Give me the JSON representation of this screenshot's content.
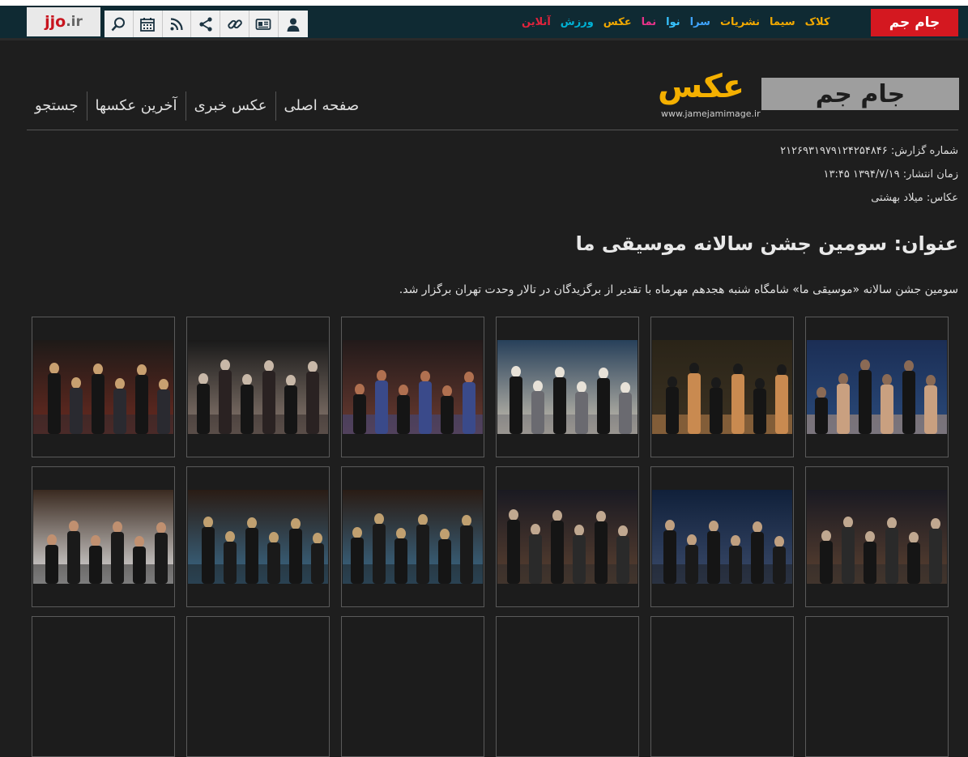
{
  "topbar": {
    "brand_left": "jjo",
    "brand_suffix": ".ir",
    "tools": [
      "user-icon",
      "newspaper-icon",
      "link-icon",
      "share-icon",
      "rss-icon",
      "calendar-icon",
      "search-icon"
    ],
    "sections": [
      {
        "label": "کلاک",
        "color": "#f2a900"
      },
      {
        "label": "سیما",
        "color": "#f2a900"
      },
      {
        "label": "نشریات",
        "color": "#f2a900"
      },
      {
        "label": "سرا",
        "color": "#3fa4ff"
      },
      {
        "label": "نوا",
        "color": "#37c3ff"
      },
      {
        "label": "نما",
        "color": "#e8338a"
      },
      {
        "label": "عکس",
        "color": "#f2a900"
      },
      {
        "label": "ورزش",
        "color": "#00b2d6"
      },
      {
        "label": "آنلاین",
        "color": "#e0233c"
      }
    ],
    "main_logo": "جام جم"
  },
  "site": {
    "logo_big": "جام جم",
    "logo_aks": "عکس",
    "url": "www.jamejamimage.ir"
  },
  "nav": [
    "صفحه اصلی",
    "عکس خبری",
    "آخرین عکسها",
    "جستجو"
  ],
  "meta": {
    "report_number": "شماره گزارش: ۲۱۲۶۹۳۱۹۷۹۱۲۴۲۵۴۸۴۶",
    "published": "زمان انتشار: ۱۳۹۴/۷/۱۹ ۱۳:۴۵",
    "photographer": "عکاس: میلاد بهشتی"
  },
  "title": "عنوان: سومین جشن سالانه موسیقی ما",
  "description": "سومین جشن سالانه «موسیقی ما» شامگاه شنبه هجدهم مهرماه با تقدیر از برگزیدگان در تالار وحدت تهران برگزار شد.",
  "photos": [
    {
      "name": "photo-1",
      "scene": "singer-close"
    },
    {
      "name": "photo-2",
      "scene": "outdoor-guests"
    },
    {
      "name": "photo-3",
      "scene": "award-handshake"
    },
    {
      "name": "photo-4",
      "scene": "screen-singer"
    },
    {
      "name": "photo-5",
      "scene": "audience"
    },
    {
      "name": "photo-6",
      "scene": "red-carpet"
    },
    {
      "name": "photo-7",
      "scene": "stage-group"
    },
    {
      "name": "photo-8",
      "scene": "screen-closeup"
    },
    {
      "name": "photo-9",
      "scene": "stage-group"
    },
    {
      "name": "photo-10",
      "scene": "stage-screen"
    },
    {
      "name": "photo-11",
      "scene": "stage-screen"
    },
    {
      "name": "photo-12",
      "scene": "screen-video"
    },
    {
      "name": "photo-13",
      "scene": "empty"
    },
    {
      "name": "photo-14",
      "scene": "empty"
    },
    {
      "name": "photo-15",
      "scene": "empty"
    },
    {
      "name": "photo-16",
      "scene": "empty"
    },
    {
      "name": "photo-17",
      "scene": "empty"
    },
    {
      "name": "photo-18",
      "scene": "empty"
    }
  ]
}
